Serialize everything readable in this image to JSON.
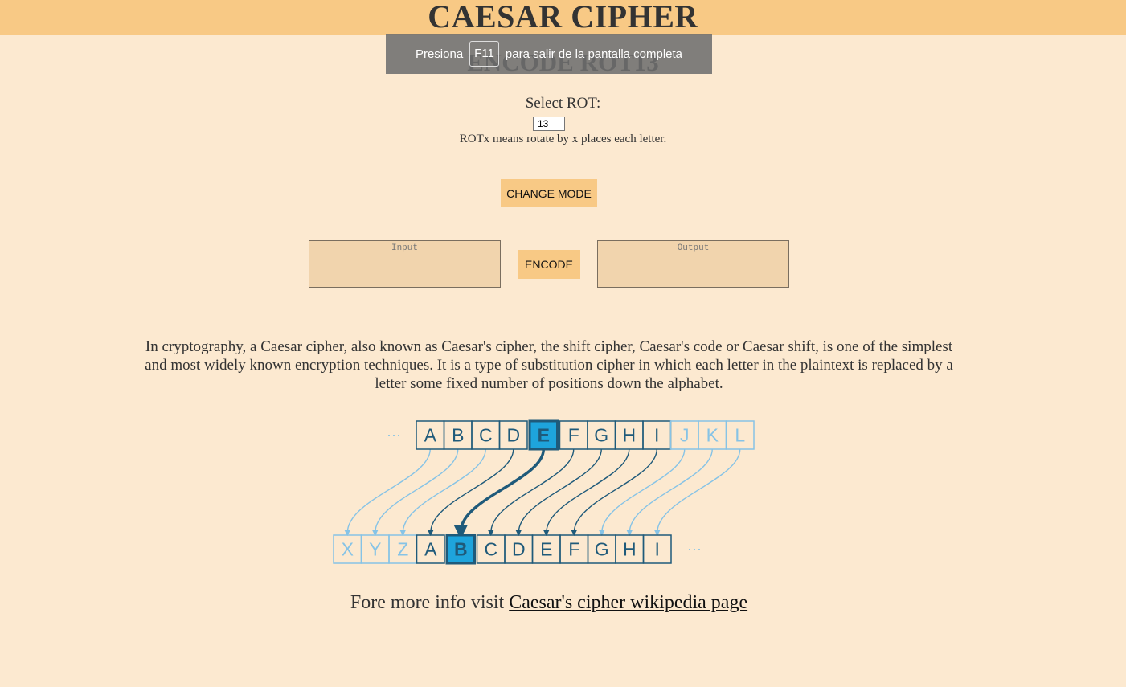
{
  "header": {
    "title": "CAESAR CIPHER"
  },
  "subtitle": "ENCODE ROT13",
  "fullscreen_notice": {
    "prefix": "Presiona",
    "key": "F11",
    "suffix": "para salir de la pantalla completa"
  },
  "rot": {
    "label": "Select ROT:",
    "value": "13",
    "help": "ROTx means rotate by x places each letter."
  },
  "buttons": {
    "change_mode": "CHANGE MODE",
    "encode": "ENCODE"
  },
  "input_box": {
    "placeholder": "Input"
  },
  "output_box": {
    "placeholder": "Output"
  },
  "description": "In cryptography, a Caesar cipher, also known as Caesar's cipher, the shift cipher, Caesar's code or Caesar shift, is one of the simplest and most widely known encryption techniques. It is a type of substitution cipher in which each letter in the plaintext is replaced by a letter some fixed number of positions down the alphabet.",
  "diagram": {
    "top_letters": [
      "A",
      "B",
      "C",
      "D",
      "E",
      "F",
      "G",
      "H",
      "I",
      "J",
      "K",
      "L"
    ],
    "bottom_letters": [
      "X",
      "Y",
      "Z",
      "A",
      "B",
      "C",
      "D",
      "E",
      "F",
      "G",
      "H",
      "I"
    ],
    "highlight_top": "E",
    "highlight_bottom": "B",
    "ellipsis": "···",
    "colors": {
      "dark": "#1f5a7a",
      "light": "#86c3e6",
      "highlight": "#1ea4dc"
    }
  },
  "more_info": {
    "text": "Fore more info visit",
    "link_text": "Caesar's cipher wikipedia page"
  }
}
